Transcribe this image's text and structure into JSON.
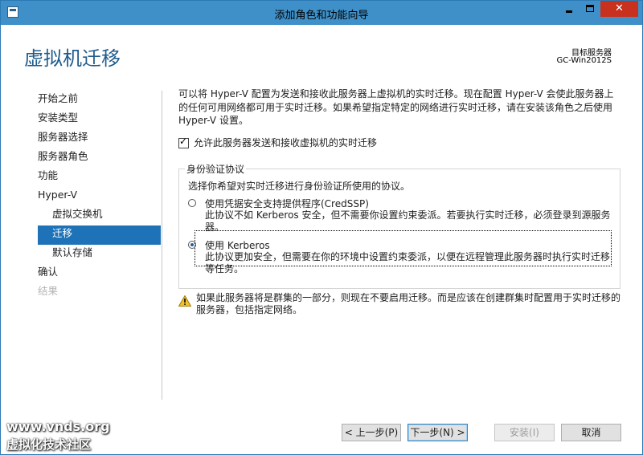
{
  "window": {
    "title": "添加角色和功能向导",
    "close_glyph": "✕"
  },
  "header": {
    "title": "虚拟机迁移",
    "target_label": "目标服务器",
    "target_value": "GC-Win2012S"
  },
  "nav": {
    "items": [
      {
        "label": "开始之前"
      },
      {
        "label": "安装类型"
      },
      {
        "label": "服务器选择"
      },
      {
        "label": "服务器角色"
      },
      {
        "label": "功能"
      },
      {
        "label": "Hyper-V"
      },
      {
        "label": "虚拟交换机"
      },
      {
        "label": "迁移"
      },
      {
        "label": "默认存储"
      },
      {
        "label": "确认"
      },
      {
        "label": "结果"
      }
    ]
  },
  "content": {
    "intro": "可以将 Hyper-V 配置为发送和接收此服务器上虚拟机的实时迁移。现在配置 Hyper-V 会使此服务器上的任何可用网络都可用于实时迁移。如果希望指定特定的网络进行实时迁移，请在安装该角色之后使用 Hyper-V 设置。",
    "allow_migration": {
      "label": "允许此服务器发送和接收虚拟机的实时迁移",
      "checked": true,
      "check_glyph": "✓"
    },
    "auth_group": {
      "legend": "身份验证协议",
      "description": "选择你希望对实时迁移进行身份验证所使用的协议。",
      "options": [
        {
          "label": "使用凭据安全支持提供程序(CredSSP)",
          "description": "此协议不如 Kerberos 安全，但不需要你设置约束委派。若要执行实时迁移，必须登录到源服务器。",
          "selected": false
        },
        {
          "label": "使用 Kerberos",
          "description": "此协议更加安全，但需要在你的环境中设置约束委派，以便在远程管理此服务器时执行实时迁移等任务。",
          "selected": true
        }
      ]
    },
    "warning_text": "如果此服务器将是群集的一部分，则现在不要启用迁移。而是应该在创建群集时配置用于实时迁移的服务器，包括指定网络。"
  },
  "buttons": {
    "prev": "< 上一步(P)",
    "next": "下一步(N) >",
    "install": "安装(I)",
    "cancel": "取消"
  },
  "watermark": {
    "line1": "www.vnds.org",
    "line2": "虚拟化技术社区"
  },
  "colors": {
    "titlebar": "#3f90c8",
    "accent": "#1e73b8",
    "close": "#c7311e",
    "header_title": "#1f5c8d"
  }
}
